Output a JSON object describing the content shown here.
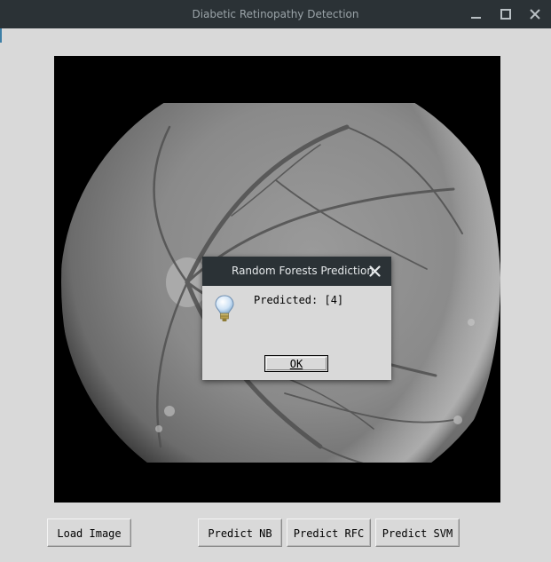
{
  "window": {
    "title": "Diabetic Retinopathy Detection",
    "controls": {
      "minimize_icon": "minimize-icon",
      "maximize_icon": "maximize-icon",
      "close_icon": "close-icon"
    },
    "titlebar_color": "#2b3236",
    "background_color": "#d9d9d9"
  },
  "image_panel": {
    "content": "grayscale fundus retina image",
    "background_color": "#000000"
  },
  "buttons": {
    "load_image": "Load Image",
    "predict_nb": "Predict NB",
    "predict_rfc": "Predict RFC",
    "predict_svm": "Predict SVM"
  },
  "dialog": {
    "title": "Random Forests Prediction",
    "icon": "lightbulb-icon",
    "message": "Predicted: [4]",
    "ok_label": "OK",
    "close_icon": "close-icon"
  }
}
